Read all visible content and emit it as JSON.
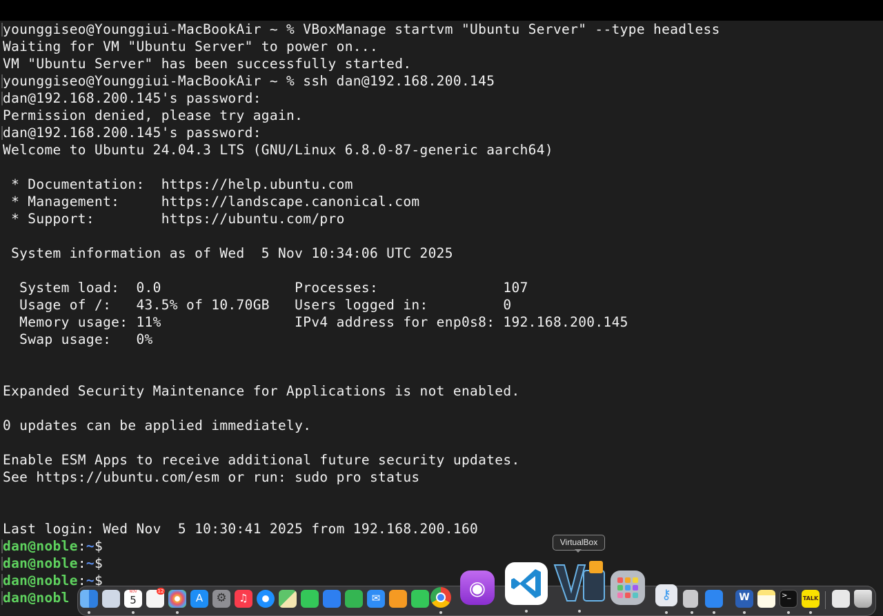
{
  "terminal": {
    "lines": [
      "younggiseo@Younggiui-MacBookAir ~ % VBoxManage startvm \"Ubuntu Server\" --type headless",
      "Waiting for VM \"Ubuntu Server\" to power on...",
      "VM \"Ubuntu Server\" has been successfully started.",
      "younggiseo@Younggiui-MacBookAir ~ % ssh dan@192.168.200.145",
      "dan@192.168.200.145's password:",
      "Permission denied, please try again.",
      "dan@192.168.200.145's password:",
      "Welcome to Ubuntu 24.04.3 LTS (GNU/Linux 6.8.0-87-generic aarch64)",
      "",
      " * Documentation:  https://help.ubuntu.com",
      " * Management:     https://landscape.canonical.com",
      " * Support:        https://ubuntu.com/pro",
      "",
      " System information as of Wed  5 Nov 10:34:06 UTC 2025",
      "",
      "  System load:  0.0                Processes:               107",
      "  Usage of /:   43.5% of 10.70GB   Users logged in:         0",
      "  Memory usage: 11%                IPv4 address for enp0s8: 192.168.200.145",
      "  Swap usage:   0%",
      "",
      "",
      "Expanded Security Maintenance for Applications is not enabled.",
      "",
      "0 updates can be applied immediately.",
      "",
      "Enable ESM Apps to receive additional future security updates.",
      "See https://ubuntu.com/esm or run: sudo pro status",
      "",
      "",
      "Last login: Wed Nov  5 10:30:41 2025 from 192.168.200.160"
    ],
    "prompts": [
      {
        "user": "dan@noble",
        "sep": ":",
        "path": "~",
        "sym": "$"
      },
      {
        "user": "dan@noble",
        "sep": ":",
        "path": "~",
        "sym": "$"
      },
      {
        "user": "dan@noble",
        "sep": ":",
        "path": "~",
        "sym": "$"
      },
      {
        "user": "dan@nobl",
        "sep": "",
        "path": "",
        "sym": ""
      }
    ],
    "colors": {
      "background": "#1e1e1e",
      "text": "#f2f2f2",
      "prompt_user": "#5fd35f",
      "prompt_path": "#5b8ff0"
    }
  },
  "dock": {
    "tooltip": "VirtualBox",
    "calendar": {
      "month": "NOV",
      "day": "5"
    },
    "reminders_badge": "12",
    "kakaotalk_label": "TALK",
    "apps": [
      {
        "name": "finder-icon",
        "color": "#3a8de8"
      },
      {
        "name": "preview-icon",
        "color": "#cfd8e6"
      },
      {
        "name": "calendar-icon",
        "color": "#ffffff"
      },
      {
        "name": "reminders-icon",
        "color": "#f5f5f5"
      },
      {
        "name": "photos-icon",
        "color": "#f0c040"
      },
      {
        "name": "app-store-icon",
        "color": "#1e8ef5"
      },
      {
        "name": "system-settings-icon",
        "color": "#8e8e93"
      },
      {
        "name": "music-icon",
        "color": "#fa3c4c"
      },
      {
        "name": "safari-icon",
        "color": "#1e90ff"
      },
      {
        "name": "maps-icon",
        "color": "#5ec46a"
      },
      {
        "name": "facetime-icon",
        "color": "#34c759"
      },
      {
        "name": "keynote-icon",
        "color": "#2e7ff0"
      },
      {
        "name": "numbers-icon",
        "color": "#34b552"
      },
      {
        "name": "mail-icon",
        "color": "#2f8df5"
      },
      {
        "name": "pages-icon",
        "color": "#f59a23"
      },
      {
        "name": "messages-icon",
        "color": "#34c759"
      },
      {
        "name": "chrome-icon",
        "color": "#e8e8e8"
      },
      {
        "name": "podcasts-icon",
        "color": "#a64ee0"
      },
      {
        "name": "vscode-icon",
        "color": "#ffffff"
      },
      {
        "name": "virtualbox-icon",
        "color": "#1f2b38"
      },
      {
        "name": "launchpad-icon",
        "color": "#b8bcc4"
      },
      {
        "name": "passwords-icon",
        "color": "#e6e9f0"
      },
      {
        "name": "iphone-mirroring-icon",
        "color": "#c9c9cc"
      },
      {
        "name": "xcode-icon",
        "color": "#2e86f0"
      },
      {
        "name": "word-icon",
        "color": "#2b5fb4"
      },
      {
        "name": "notes-icon",
        "color": "#fde57a"
      },
      {
        "name": "terminal-icon",
        "color": "#111111"
      },
      {
        "name": "kakaotalk-icon",
        "color": "#fae100"
      },
      {
        "name": "downloads-icon",
        "color": "#e8e8e8"
      },
      {
        "name": "trash-icon",
        "color": "#d0d0d0"
      }
    ]
  }
}
